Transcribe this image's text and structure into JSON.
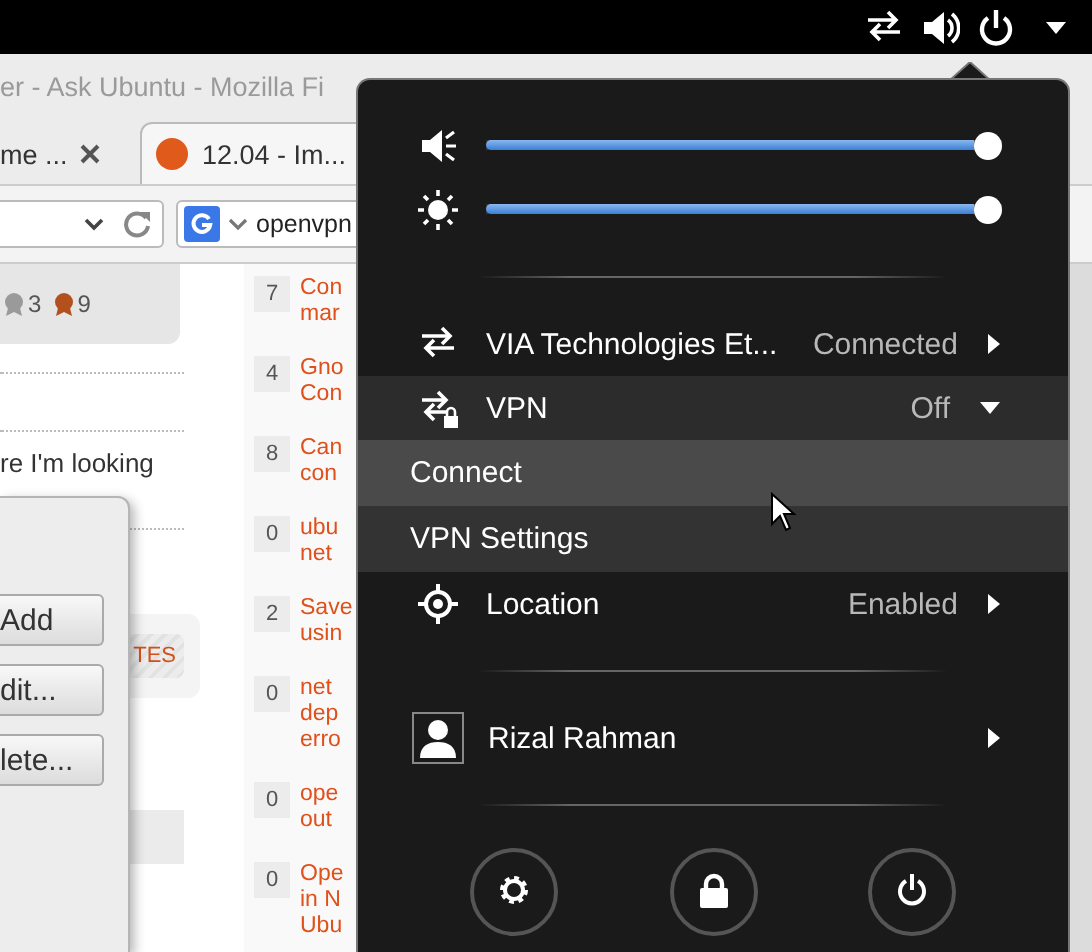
{
  "browser": {
    "title": "er - Ask Ubuntu - Mozilla Fi",
    "tabs": [
      {
        "label": "me ...",
        "selected": false
      },
      {
        "label": "12.04 - Im...",
        "selected": true
      }
    ],
    "search_field": {
      "value": "openvpn"
    }
  },
  "page": {
    "badges": [
      {
        "count": "3",
        "color": "#9a9a9a"
      },
      {
        "count": "9",
        "color": "#b4501e"
      }
    ],
    "snippet": "re I'm looking",
    "tag": "TES",
    "related": [
      {
        "votes": "7",
        "lines": [
          "Con",
          "mar"
        ]
      },
      {
        "votes": "4",
        "lines": [
          "Gno",
          "Con"
        ]
      },
      {
        "votes": "8",
        "lines": [
          "Can",
          "con"
        ]
      },
      {
        "votes": "0",
        "lines": [
          "ubu",
          "net"
        ]
      },
      {
        "votes": "2",
        "lines": [
          "Save",
          "usin"
        ]
      },
      {
        "votes": "0",
        "lines": [
          "net",
          "dep",
          "erro"
        ]
      },
      {
        "votes": "0",
        "lines": [
          "ope",
          "out"
        ]
      },
      {
        "votes": "0",
        "lines": [
          "Ope",
          "in N",
          "Ubu"
        ]
      }
    ]
  },
  "dialog": {
    "buttons": [
      "Add",
      "dit...",
      "lete..."
    ]
  },
  "system_menu": {
    "sliders": [
      {
        "kind": "volume",
        "level": 1
      },
      {
        "kind": "brightness",
        "level": 1
      }
    ],
    "items": [
      {
        "kind": "network",
        "label": "VIA Technologies Et...",
        "status": "Connected",
        "expanded": false
      },
      {
        "kind": "vpn",
        "label": "VPN",
        "status": "Off",
        "expanded": true,
        "children": [
          {
            "label": "Connect",
            "selected": true
          },
          {
            "label": "VPN Settings",
            "selected": false
          }
        ]
      },
      {
        "kind": "location",
        "label": "Location",
        "status": "Enabled",
        "expanded": false
      }
    ],
    "user": {
      "name": "Rizal Rahman"
    },
    "actions": [
      {
        "kind": "settings"
      },
      {
        "kind": "lock"
      },
      {
        "kind": "power"
      }
    ]
  }
}
